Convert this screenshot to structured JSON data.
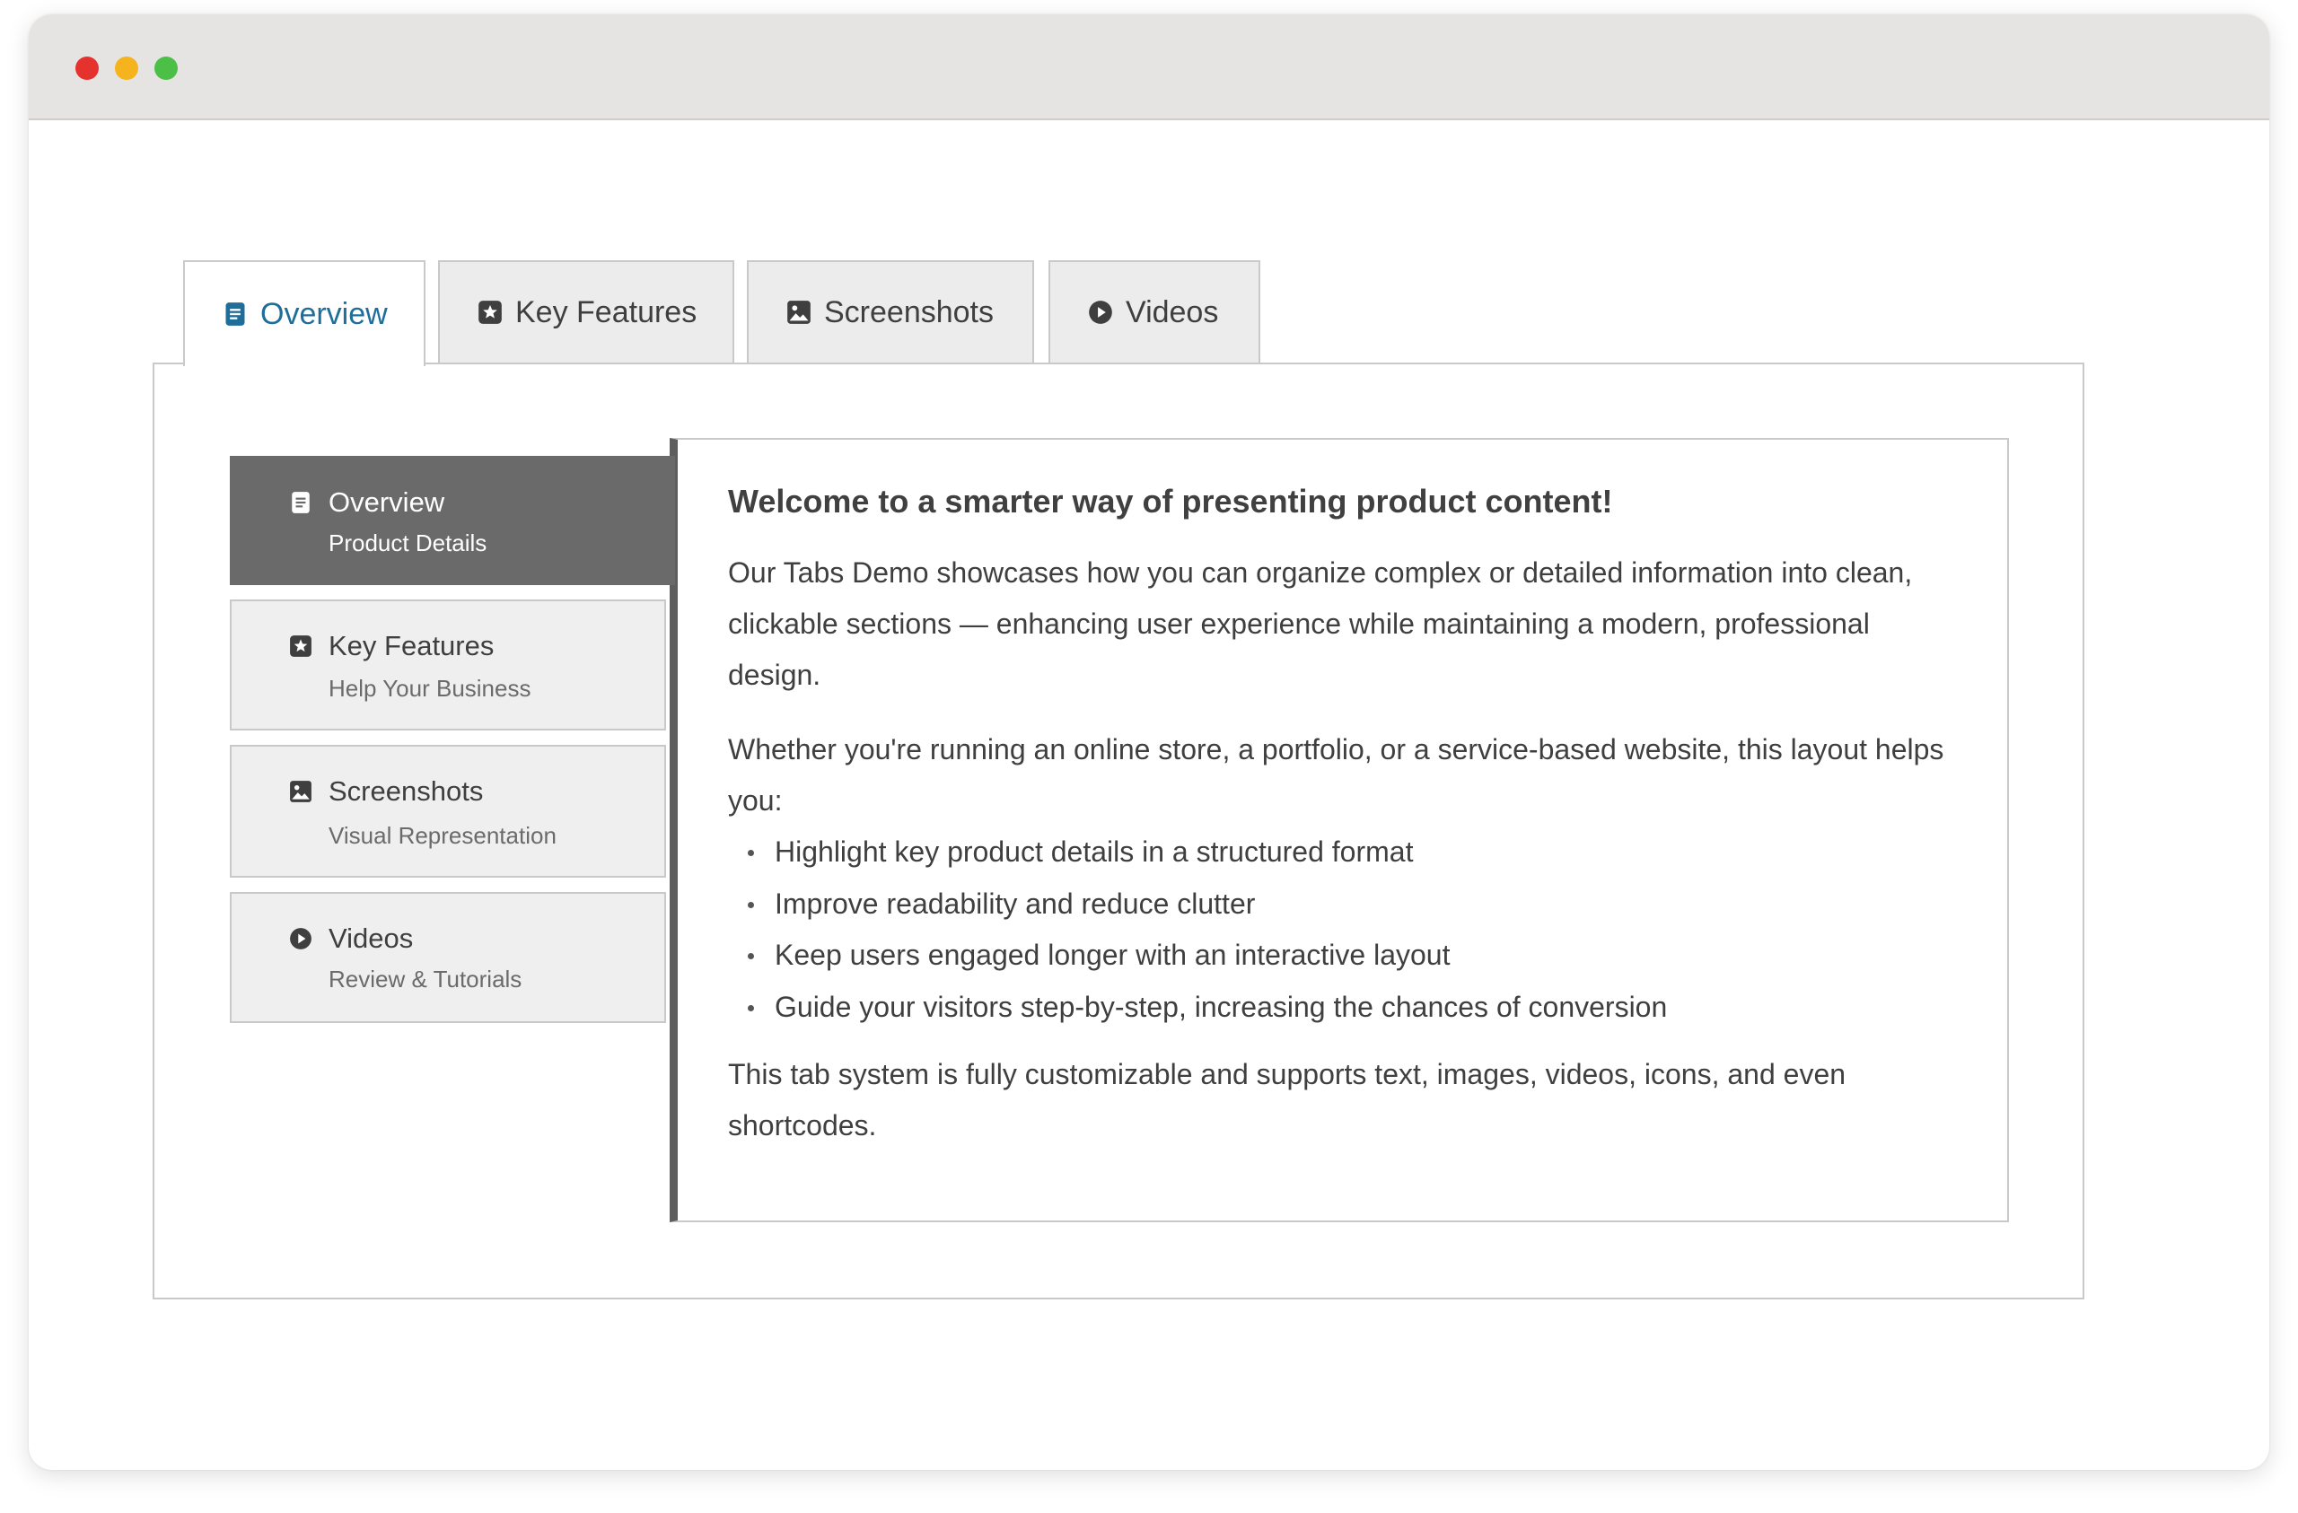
{
  "window": {
    "controls": [
      "close",
      "minimize",
      "zoom"
    ]
  },
  "top_tabs": [
    {
      "label": "Overview",
      "icon": "document-icon",
      "active": true
    },
    {
      "label": "Key Features",
      "icon": "star-badge-icon",
      "active": false
    },
    {
      "label": "Screenshots",
      "icon": "image-icon",
      "active": false
    },
    {
      "label": "Videos",
      "icon": "play-circle-icon",
      "active": false
    }
  ],
  "side_tabs": [
    {
      "title": "Overview",
      "subtitle": "Product Details",
      "icon": "document-icon",
      "active": true
    },
    {
      "title": "Key Features",
      "subtitle": "Help Your Business",
      "icon": "star-badge-icon",
      "active": false
    },
    {
      "title": "Screenshots",
      "subtitle": "Visual Representation",
      "icon": "image-icon",
      "active": false
    },
    {
      "title": "Videos",
      "subtitle": "Review & Tutorials",
      "icon": "play-circle-icon",
      "active": false
    }
  ],
  "content": {
    "heading": "Welcome to a smarter way of presenting product content!",
    "paragraph1": "Our Tabs Demo showcases how you can organize complex or detailed information into clean, clickable sections — enhancing user experience while maintaining a modern, professional design.",
    "paragraph2": "Whether you're running an online store, a portfolio, or a service-based website, this layout helps you:",
    "bullets": [
      "Highlight key product details in a structured format",
      "Improve readability and reduce clutter",
      "Keep users engaged longer with an interactive layout",
      "Guide your visitors step-by-step, increasing the chances of conversion"
    ],
    "paragraph3": "This tab system is fully customizable and supports text, images, videos, icons, and even shortcodes."
  },
  "colors": {
    "accent": "#1f6e9a",
    "active_side_tab": "#6a6a6a",
    "tab_background": "#ececec",
    "border": "#c9c9c9",
    "text": "#3f3f3f"
  }
}
